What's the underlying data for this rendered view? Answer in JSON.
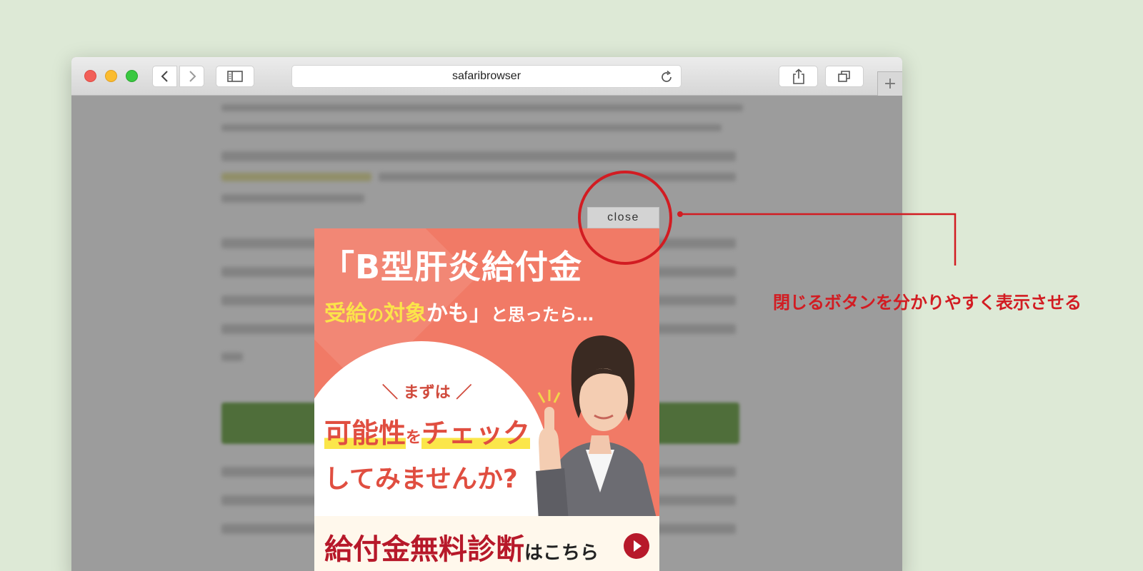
{
  "browser": {
    "address": "safaribrowser",
    "newtab_label": "+"
  },
  "popup": {
    "close_label": "close"
  },
  "ad": {
    "title": "「B型肝炎給付金",
    "sub_a": "受給",
    "sub_b": "の",
    "sub_c": "対象",
    "sub_d": "かも」",
    "sub_e": "と思ったら…",
    "first": "＼ まずは ／",
    "check_a": "可能性",
    "check_b": "を",
    "check_c": "チェック",
    "try": "してみませんか?",
    "cta_main": "給付金無料診断",
    "cta_sub": "はこちら"
  },
  "annotation": {
    "text": "閉じるボタンを分かりやすく表示させる"
  },
  "colors": {
    "accent_red": "#d21c22",
    "ad_bg": "#f17a66",
    "highlight_yellow": "#fbe44a"
  }
}
